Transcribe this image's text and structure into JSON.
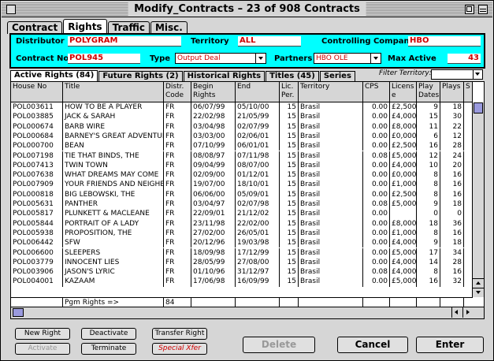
{
  "window": {
    "title": "Modify_Contracts – 23 of 908 Contracts"
  },
  "tabs": [
    "Contract",
    "Rights",
    "Traffic",
    "Misc."
  ],
  "active_tab": "Rights",
  "header": {
    "distributor_label": "Distributor",
    "distributor_value": "POLYGRAM",
    "territory_label": "Territory",
    "territory_value": "ALL",
    "controlling_company_label": "Controlling Company",
    "controlling_company_value": "HBO",
    "contract_no_label": "Contract No",
    "contract_no_value": "POL945",
    "type_label": "Type",
    "type_value": "Output Deal",
    "partners_label": "Partners",
    "partners_value": "HBO OLE",
    "max_active_label": "Max Active",
    "max_active_value": "43"
  },
  "subtabs": [
    "Active Rights (84)",
    "Future Rights (2)",
    "Historical Rights",
    "Titles (45)",
    "Series"
  ],
  "filter_territory_label": "Filter Territory:",
  "table": {
    "columns": [
      "House No",
      "Title",
      "Distr. Code",
      "Begin Rights",
      "End",
      "Lic. Per.",
      "Territory",
      "CPS",
      "Licens e",
      "Play Dates",
      "Plays",
      "S"
    ],
    "rows": [
      [
        "POL003611",
        "HOW TO BE A PLAYER",
        "FR",
        "06/07/99",
        "05/10/00",
        "15",
        "Brasil",
        "0.00",
        "£2,500",
        "9",
        "18"
      ],
      [
        "POL003885",
        "JACK & SARAH",
        "FR",
        "22/02/98",
        "21/05/99",
        "15",
        "Brasil",
        "0.00",
        "£4,000",
        "15",
        "30"
      ],
      [
        "POL000674",
        "BARB WIRE",
        "FR",
        "03/04/98",
        "02/07/99",
        "15",
        "Brasil",
        "0.00",
        "£8,000",
        "11",
        "22"
      ],
      [
        "POL000684",
        "BARNEY'S GREAT ADVENTUR",
        "FR",
        "03/03/00",
        "02/06/01",
        "15",
        "Brasil",
        "0.00",
        "£0,000",
        "6",
        "12"
      ],
      [
        "POL000700",
        "BEAN",
        "FR",
        "07/10/99",
        "06/01/01",
        "15",
        "Brasil",
        "0.00",
        "£2,500",
        "16",
        "28"
      ],
      [
        "POL007198",
        "TIE THAT BINDS, THE",
        "FR",
        "08/08/97",
        "07/11/98",
        "15",
        "Brasil",
        "0.08",
        "£5,000",
        "12",
        "24"
      ],
      [
        "POL007413",
        "TWIN TOWN",
        "FR",
        "09/04/99",
        "08/07/00",
        "15",
        "Brasil",
        "0.00",
        "£4,000",
        "10",
        "20"
      ],
      [
        "POL007638",
        "WHAT DREAMS MAY COME",
        "FR",
        "02/09/00",
        "01/12/01",
        "15",
        "Brasil",
        "0.00",
        "£0,000",
        "8",
        "16"
      ],
      [
        "POL007909",
        "YOUR FRIENDS AND NEIGHBO",
        "FR",
        "19/07/00",
        "18/10/01",
        "15",
        "Brasil",
        "0.00",
        "£1,000",
        "8",
        "16"
      ],
      [
        "POL000818",
        "BIG LEBOWSKI, THE",
        "FR",
        "06/06/00",
        "05/09/01",
        "15",
        "Brasil",
        "0.00",
        "£2,500",
        "8",
        "16"
      ],
      [
        "POL005631",
        "PANTHER",
        "FR",
        "03/04/97",
        "02/07/98",
        "15",
        "Brasil",
        "0.08",
        "£5,000",
        "9",
        "18"
      ],
      [
        "POL005817",
        "PLUNKETT & MACLEANE",
        "FR",
        "22/09/01",
        "21/12/02",
        "15",
        "Brasil",
        "0.00",
        "",
        "0",
        "0"
      ],
      [
        "POL005844",
        "PORTRAIT OF A LADY",
        "FR",
        "23/11/98",
        "22/02/00",
        "15",
        "Brasil",
        "0.00",
        "£8,000",
        "18",
        "36"
      ],
      [
        "POL005938",
        "PROPOSITION, THE",
        "FR",
        "27/02/00",
        "26/05/01",
        "15",
        "Brasil",
        "0.00",
        "£1,000",
        "8",
        "16"
      ],
      [
        "POL006442",
        "SFW",
        "FR",
        "20/12/96",
        "19/03/98",
        "15",
        "Brasil",
        "0.00",
        "£4,000",
        "9",
        "18"
      ],
      [
        "POL006600",
        "SLEEPERS",
        "FR",
        "18/09/98",
        "17/12/99",
        "15",
        "Brasil",
        "0.00",
        "£5,000",
        "17",
        "34"
      ],
      [
        "POL003779",
        "INNOCENT LIES",
        "FR",
        "28/05/99",
        "27/08/00",
        "15",
        "Brasil",
        "0.00",
        "£4,000",
        "14",
        "28"
      ],
      [
        "POL003906",
        "JASON'S LYRIC",
        "FR",
        "01/10/96",
        "31/12/97",
        "15",
        "Brasil",
        "0.08",
        "£4,000",
        "8",
        "16"
      ],
      [
        "POL004001",
        "KAZAAM",
        "FR",
        "17/06/98",
        "16/09/99",
        "15",
        "Brasil",
        "0.00",
        "£5,000",
        "16",
        "32"
      ]
    ],
    "footer_label": "Pgm Rights =>",
    "footer_value": "84"
  },
  "buttons": {
    "new_right": "New Right",
    "deactivate": "Deactivate",
    "transfer_right": "Transfer Right",
    "activate": "Activate",
    "terminate": "Terminate",
    "special_xfer": "Special Xfer",
    "delete": "Delete",
    "cancel": "Cancel",
    "enter": "Enter"
  },
  "colors": {
    "header_panel_bg": "#00ffff",
    "value_text": "#d00000",
    "scroll_thumb": "#9a9ade"
  }
}
